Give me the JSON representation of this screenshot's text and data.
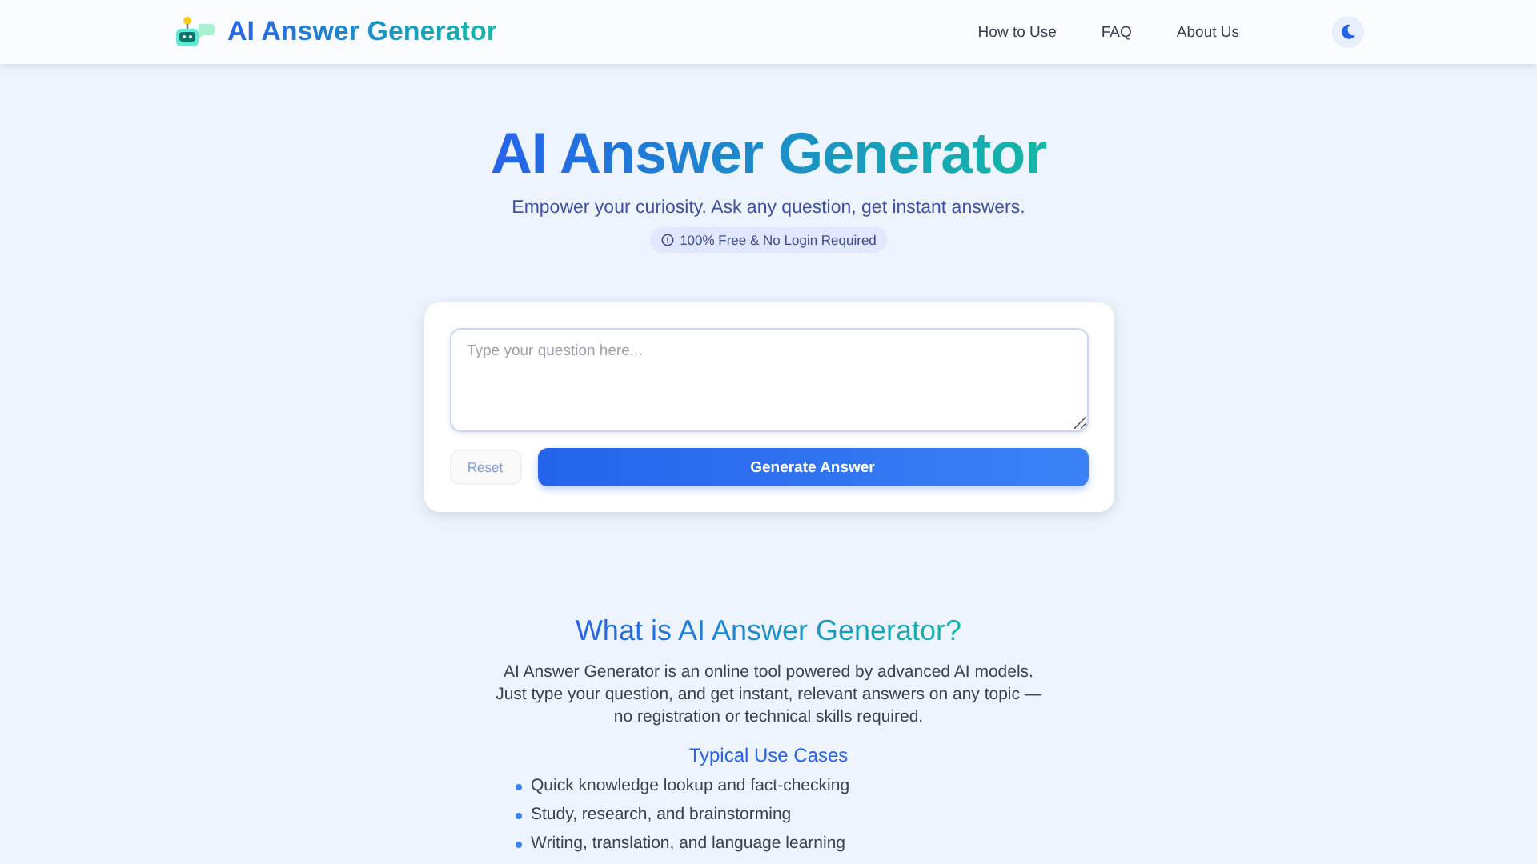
{
  "header": {
    "brand": "AI Answer Generator",
    "nav": [
      "How to Use",
      "FAQ",
      "About Us"
    ]
  },
  "hero": {
    "title": "AI Answer Generator",
    "subtitle": "Empower your curiosity. Ask any question, get instant answers.",
    "badge": "100% Free & No Login Required"
  },
  "form": {
    "placeholder": "Type your question here...",
    "reset": "Reset",
    "submit": "Generate Answer"
  },
  "about": {
    "heading": "What is AI Answer Generator?",
    "text": "AI Answer Generator is an online tool powered by advanced AI models. Just type your question, and get instant, relevant answers on any topic — no registration or technical skills required.",
    "use_cases_heading": "Typical Use Cases",
    "use_cases": [
      "Quick knowledge lookup and fact-checking",
      "Study, research, and brainstorming",
      "Writing, translation, and language learning"
    ]
  }
}
